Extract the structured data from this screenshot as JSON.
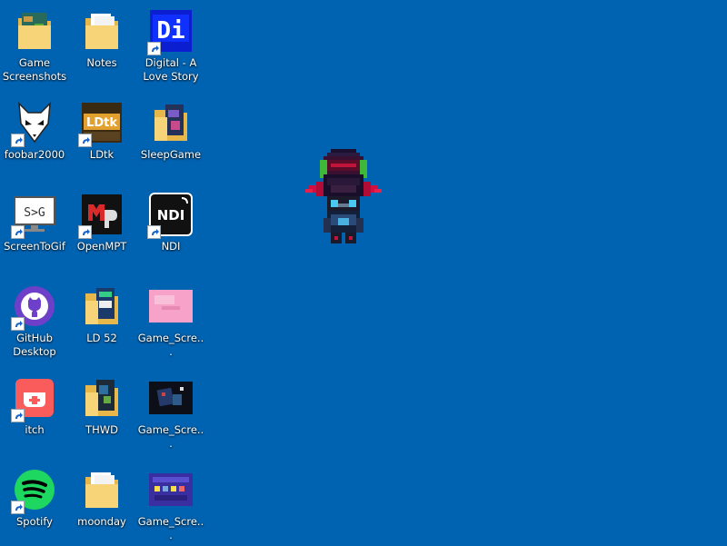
{
  "desktop": {
    "background_color": "#0063b1",
    "icons": [
      {
        "label": "Game\nScreenshots",
        "icon": "folder-icon"
      },
      {
        "label": "Notes",
        "icon": "folder-icon"
      },
      {
        "label": "Digital - A\nLove Story",
        "icon": "digital-app-icon"
      },
      {
        "label": "foobar2000",
        "icon": "foobar2000-icon"
      },
      {
        "label": "LDtk",
        "icon": "ldtk-icon"
      },
      {
        "label": "SleepGame",
        "icon": "folder-icon"
      },
      {
        "label": "ScreenToGif",
        "icon": "screentogif-icon"
      },
      {
        "label": "OpenMPT",
        "icon": "openmpt-icon"
      },
      {
        "label": "NDI",
        "icon": "ndi-icon"
      },
      {
        "label": "GitHub\nDesktop",
        "icon": "github-icon"
      },
      {
        "label": "LD 52",
        "icon": "folder-icon"
      },
      {
        "label": "Game_Scre...",
        "icon": "image-thumbnail-icon"
      },
      {
        "label": "itch",
        "icon": "itch-icon"
      },
      {
        "label": "THWD",
        "icon": "folder-icon"
      },
      {
        "label": "Game_Scre...",
        "icon": "image-thumbnail-icon"
      },
      {
        "label": "Spotify",
        "icon": "spotify-icon"
      },
      {
        "label": "moonday",
        "icon": "folder-icon"
      },
      {
        "label": "Game_Scre...",
        "icon": "image-thumbnail-icon"
      }
    ],
    "sprite": {
      "name": "pixel-character-sprite"
    }
  }
}
